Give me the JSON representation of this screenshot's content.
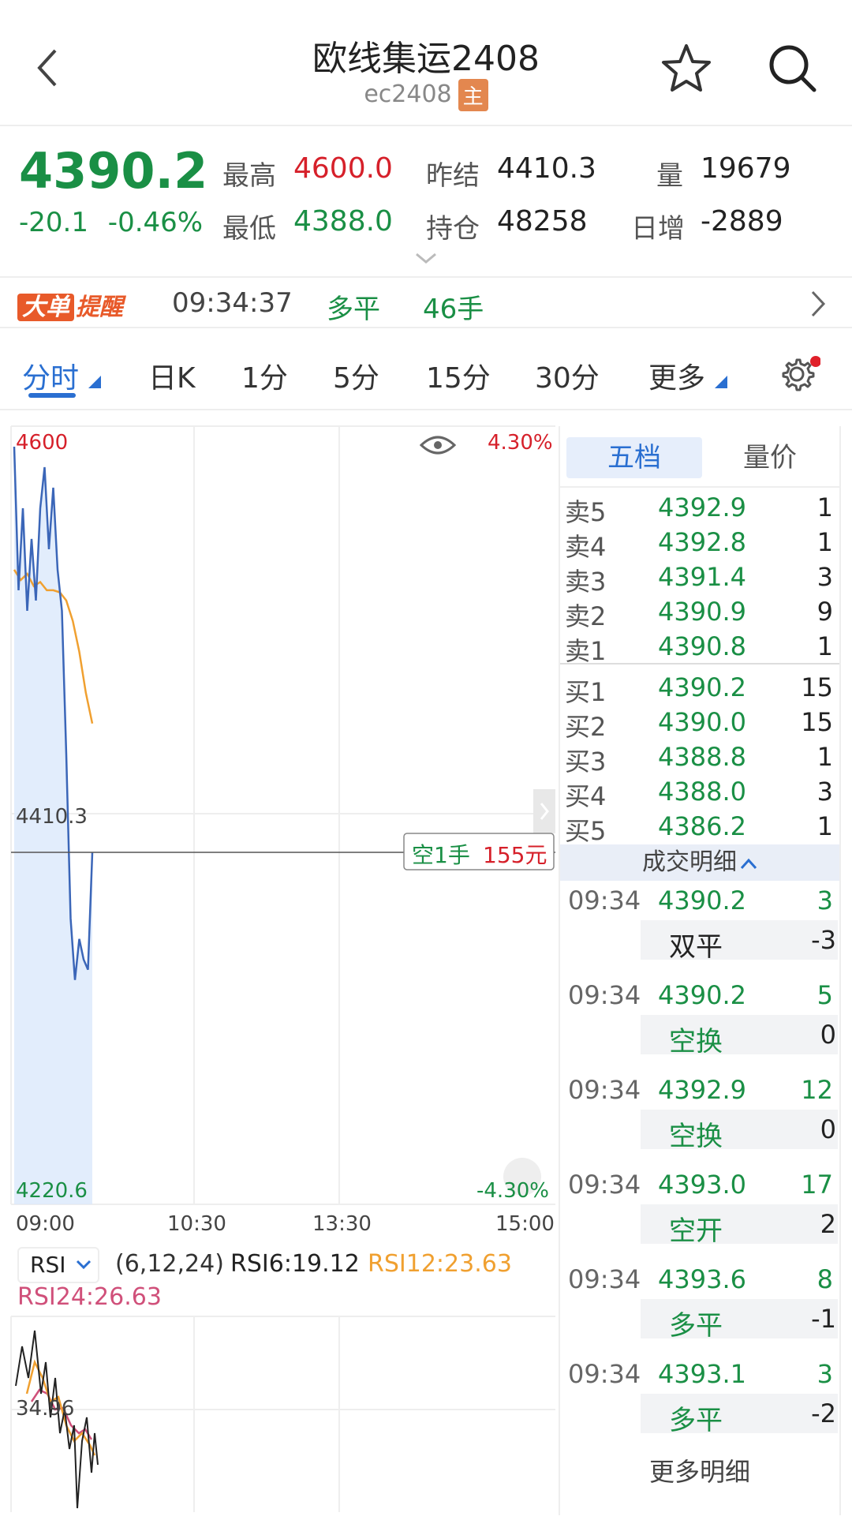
{
  "header": {
    "title": "欧线集运2408",
    "code": "ec2408",
    "main_badge": "主"
  },
  "quote": {
    "last": "4390.2",
    "change": "-20.1",
    "change_pct": "-0.46%",
    "high_label": "最高",
    "high": "4600.0",
    "low_label": "最低",
    "low": "4388.0",
    "prev_settle_label": "昨结",
    "prev_settle": "4410.3",
    "open_interest_label": "持仓",
    "open_interest": "48258",
    "volume_label": "量",
    "volume": "19679",
    "daily_inc_label": "日增",
    "daily_inc": "-2889"
  },
  "alert": {
    "badge1": "大单",
    "badge2": "提醒",
    "time": "09:34:37",
    "type": "多平",
    "lots": "46手"
  },
  "tabs": [
    "分时",
    "日K",
    "1分",
    "5分",
    "15分",
    "30分",
    "更多"
  ],
  "chart": {
    "y_top": "4600",
    "y_mid": "4410.3",
    "y_bottom": "4220.6",
    "pct_top": "4.30%",
    "pct_bottom": "-4.30%",
    "x_labels": [
      "09:00",
      "10:30",
      "13:30",
      "15:00"
    ],
    "tag_side": "空1手",
    "tag_amount": "155元",
    "price_series": [
      4590,
      4520,
      4560,
      4510,
      4545,
      4515,
      4560,
      4580,
      4540,
      4570,
      4530,
      4510,
      4440,
      4360,
      4330,
      4350,
      4340,
      4335,
      4392
    ],
    "avg_series": [
      4530,
      4525,
      4528,
      4522,
      4524,
      4520,
      4520,
      4519,
      4515,
      4505,
      4490,
      4470,
      4455
    ],
    "colors": {
      "price": "#3b66b8",
      "avg": "#f0a030",
      "fill": "#dbe9fb"
    }
  },
  "rsi": {
    "name": "RSI",
    "params": "(6,12,24)",
    "rsi6": "RSI6:19.12",
    "rsi12": "RSI12:23.63",
    "rsi24": "RSI24:26.63",
    "level": "34.96",
    "colors": {
      "rsi6": "#222222",
      "rsi12": "#f0a030",
      "rsi24": "#d0507a"
    }
  },
  "orderbook": {
    "tab_active": "五档",
    "tab_other": "量价",
    "asks": [
      {
        "label": "卖5",
        "price": "4392.9",
        "qty": "1"
      },
      {
        "label": "卖4",
        "price": "4392.8",
        "qty": "1"
      },
      {
        "label": "卖3",
        "price": "4391.4",
        "qty": "3"
      },
      {
        "label": "卖2",
        "price": "4390.9",
        "qty": "9"
      },
      {
        "label": "卖1",
        "price": "4390.8",
        "qty": "1"
      }
    ],
    "bids": [
      {
        "label": "买1",
        "price": "4390.2",
        "qty": "15"
      },
      {
        "label": "买2",
        "price": "4390.0",
        "qty": "15"
      },
      {
        "label": "买3",
        "price": "4388.8",
        "qty": "1"
      },
      {
        "label": "买4",
        "price": "4388.0",
        "qty": "3"
      },
      {
        "label": "买5",
        "price": "4386.2",
        "qty": "1"
      }
    ],
    "trades_title": "成交明细",
    "trades": [
      {
        "time": "09:34",
        "price": "4390.2",
        "vol": "3",
        "kind": "双平",
        "oi": "-3"
      },
      {
        "time": "09:34",
        "price": "4390.2",
        "vol": "5",
        "kind": "空换",
        "oi": "0"
      },
      {
        "time": "09:34",
        "price": "4392.9",
        "vol": "12",
        "kind": "空换",
        "oi": "0"
      },
      {
        "time": "09:34",
        "price": "4393.0",
        "vol": "17",
        "kind": "空开",
        "oi": "2"
      },
      {
        "time": "09:34",
        "price": "4393.6",
        "vol": "8",
        "kind": "多平",
        "oi": "-1"
      },
      {
        "time": "09:34",
        "price": "4393.1",
        "vol": "3",
        "kind": "多平",
        "oi": "-2"
      }
    ],
    "more": "更多明细"
  }
}
